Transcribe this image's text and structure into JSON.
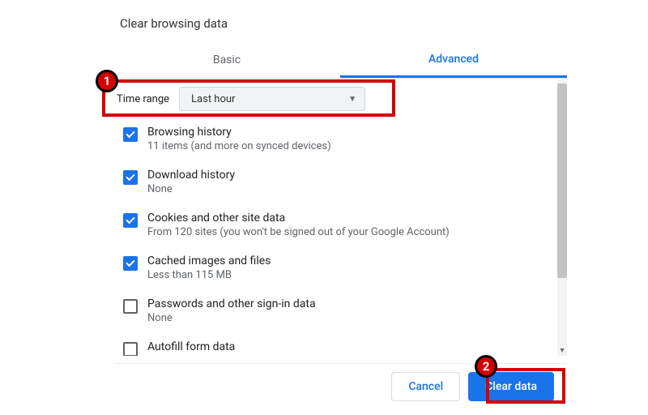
{
  "title": "Clear browsing data",
  "tabs": {
    "basic": "Basic",
    "advanced": "Advanced"
  },
  "time_range": {
    "label": "Time range",
    "value": "Last hour"
  },
  "options": [
    {
      "title": "Browsing history",
      "desc": "11 items (and more on synced devices)",
      "checked": true
    },
    {
      "title": "Download history",
      "desc": "None",
      "checked": true
    },
    {
      "title": "Cookies and other site data",
      "desc": "From 120 sites (you won't be signed out of your Google Account)",
      "checked": true
    },
    {
      "title": "Cached images and files",
      "desc": "Less than 115 MB",
      "checked": true
    },
    {
      "title": "Passwords and other sign-in data",
      "desc": "None",
      "checked": false
    },
    {
      "title": "Autofill form data",
      "desc": "",
      "checked": false
    }
  ],
  "buttons": {
    "cancel": "Cancel",
    "clear": "Clear data"
  },
  "annotations": {
    "one": "1",
    "two": "2"
  }
}
